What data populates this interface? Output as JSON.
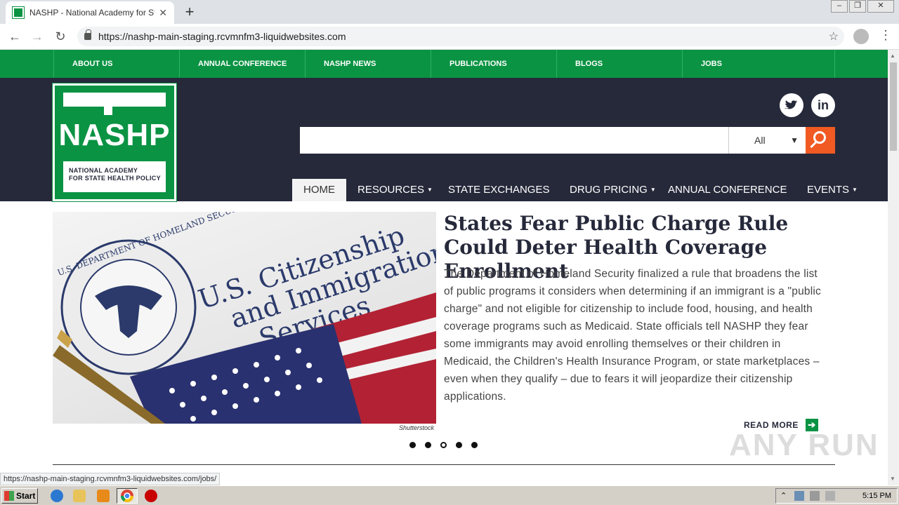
{
  "browser": {
    "tab_title": "NASHP - National Academy for State",
    "url": "https://nashp-main-staging.rcvmnfm3-liquidwebsites.com",
    "status_url": "https://nashp-main-staging.rcvmnfm3-liquidwebsites.com/jobs/"
  },
  "topnav": [
    "ABOUT US",
    "ANNUAL CONFERENCE",
    "NASHP NEWS",
    "PUBLICATIONS",
    "BLOGS",
    "JOBS"
  ],
  "logo": {
    "name": "NASHP",
    "line1": "NATIONAL ACADEMY",
    "line2": "FOR STATE HEALTH POLICY"
  },
  "social": {
    "twitter": "twitter-icon",
    "linkedin": "in"
  },
  "search": {
    "placeholder": "",
    "scope": "All"
  },
  "mainnav": [
    {
      "label": "HOME"
    },
    {
      "label": "RESOURCES"
    },
    {
      "label": "STATE EXCHANGES"
    },
    {
      "label": "DRUG PRICING"
    },
    {
      "label": "ANNUAL CONFERENCE"
    },
    {
      "label": "EVENTS"
    }
  ],
  "hero": {
    "headline": "States Fear Public Charge Rule Could Deter Health Coverage Enrollment",
    "summary": "The Department of Homeland Security finalized a rule that broadens the list of public programs it considers when determining if an immigrant is a \"public charge\" and not eligible for citizenship to include food, housing, and health coverage programs such as Medicaid. State officials tell NASHP they fear some immigrants may avoid enrolling themselves or their children in Medicaid, the Children's Health Insurance Program, or state marketplaces – even when they qualify – due to fears it will jeopardize their citizenship applications.",
    "image_credit": "Shutterstock",
    "image_text_line1": "U.S. Citizenship",
    "image_text_line2": "and Immigration",
    "image_text_line3": "Services",
    "seal_text": "U.S. DEPARTMENT OF HOMELAND SECURITY",
    "read_more": "READ MORE",
    "slides_total": 5,
    "active_slide": 3
  },
  "watermark": "ANY RUN",
  "taskbar": {
    "start": "Start",
    "time": "5:15 PM"
  },
  "colors": {
    "green": "#0a9343",
    "navy": "#26293a",
    "orange": "#f15a22"
  }
}
